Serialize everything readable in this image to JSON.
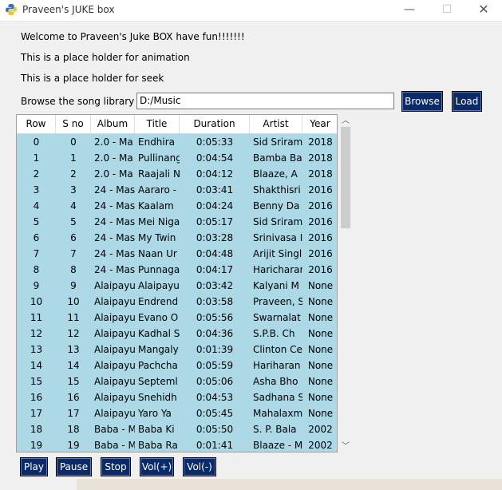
{
  "window": {
    "title": "Praveen's JUKE box",
    "minimize": "—",
    "maximize": "☐",
    "close": "✕"
  },
  "labels": {
    "welcome": "Welcome to Praveen's Juke BOX have fun!!!!!!!",
    "animation": "This is a place holder for animation",
    "seek": "This is a place holder for seek",
    "browse_library": "Browse the song library"
  },
  "library": {
    "path_value": "D:/Music",
    "browse_label": "Browse",
    "load_label": "Load"
  },
  "table": {
    "columns": [
      "Row",
      "S no",
      "Album",
      "Title",
      "Duration",
      "Artist",
      "Year"
    ],
    "rows": [
      [
        "0",
        "0",
        "2.0 - Ma",
        "Endhira",
        "0:05:33",
        "Sid Sriram",
        "2018"
      ],
      [
        "1",
        "1",
        "2.0 - Ma",
        "Pullinang",
        "0:04:54",
        "Bamba Ba",
        "2018"
      ],
      [
        "2",
        "2",
        "2.0 - Ma",
        "Raajali N",
        "0:04:12",
        "Blaaze, A",
        "2018"
      ],
      [
        "3",
        "3",
        "24 - Mas",
        "Aararo -",
        "0:03:41",
        "Shakthisri",
        "2016"
      ],
      [
        "4",
        "4",
        "24 - Mas",
        "Kaalam",
        "0:04:24",
        "Benny Da",
        "2016"
      ],
      [
        "5",
        "5",
        "24 - Mas",
        "Mei Niga",
        "0:05:17",
        "Sid Sriram",
        "2016"
      ],
      [
        "6",
        "6",
        "24 - Mas",
        "My Twin",
        "0:03:28",
        "Srinivasa I",
        "2016"
      ],
      [
        "7",
        "7",
        "24 - Mas",
        "Naan Ur",
        "0:04:48",
        "Arijit Singl",
        "2016"
      ],
      [
        "8",
        "8",
        "24 - Mas",
        "Punnaga",
        "0:04:17",
        "Haricharar",
        "2016"
      ],
      [
        "9",
        "9",
        "Alaipayu",
        "Alaipayu",
        "0:03:42",
        "Kalyani M",
        "None"
      ],
      [
        "10",
        "10",
        "Alaipayu",
        "Endrend",
        "0:03:58",
        "Praveen, S",
        "None"
      ],
      [
        "11",
        "11",
        "Alaipayu",
        "Evano O",
        "0:05:56",
        "Swarnalat",
        "None"
      ],
      [
        "12",
        "12",
        "Alaipayu",
        "Kadhal S",
        "0:04:36",
        "S.P.B. Ch",
        "None"
      ],
      [
        "13",
        "13",
        "Alaipayu",
        "Mangaly",
        "0:01:39",
        "Clinton Ce",
        "None"
      ],
      [
        "14",
        "14",
        "Alaipayu",
        "Pachcha",
        "0:05:59",
        "Hariharan",
        "None"
      ],
      [
        "15",
        "15",
        "Alaipayu",
        "Septeml",
        "0:05:06",
        "Asha Bho",
        "None"
      ],
      [
        "16",
        "16",
        "Alaipayu",
        "Snehidh",
        "0:04:53",
        "Sadhana S",
        "None"
      ],
      [
        "17",
        "17",
        "Alaipayu",
        "Yaro Ya",
        "0:05:45",
        "Mahalaxm",
        "None"
      ],
      [
        "18",
        "18",
        "Baba - M",
        "Baba Ki",
        "0:05:50",
        "S. P. Bala",
        "2002"
      ],
      [
        "19",
        "19",
        "Baba - M",
        "Baba Ra",
        "0:01:41",
        "Blaaze - M",
        "2002"
      ]
    ]
  },
  "controls": {
    "play": "Play",
    "pause": "Pause",
    "stop": "Stop",
    "vol_up": "Vol(+)",
    "vol_down": "Vol(-)"
  },
  "colors": {
    "table_bg": "#add8e6",
    "button_bg": "#0b2a6a"
  }
}
